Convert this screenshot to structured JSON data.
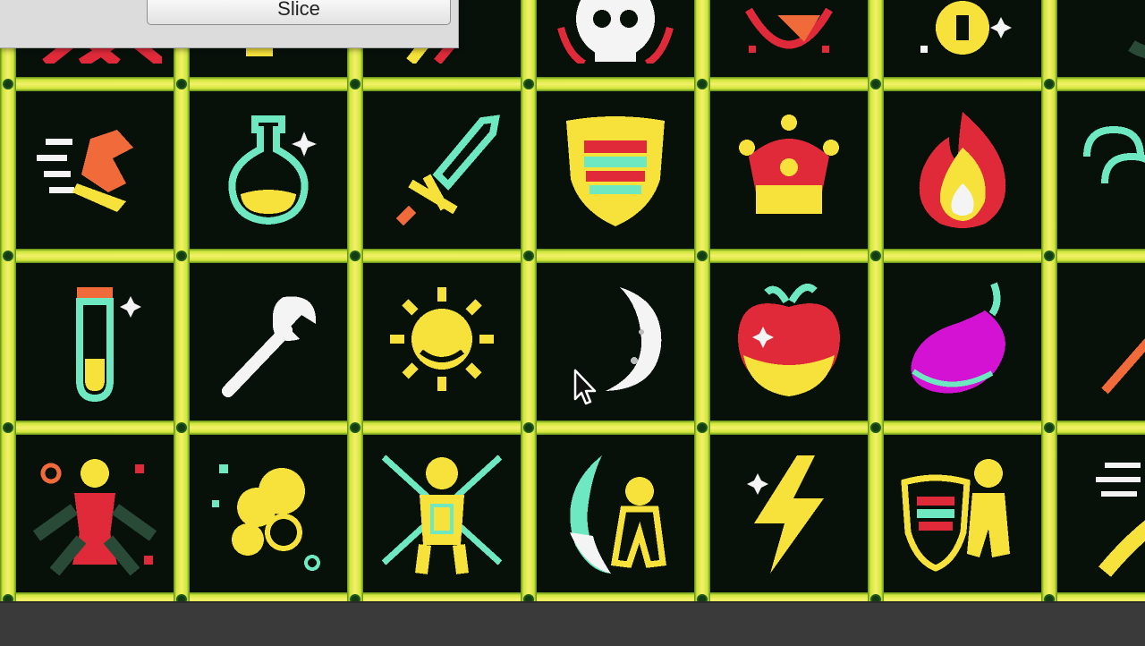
{
  "toolbar": {
    "slice_label": "Slice"
  },
  "sprite_sheet": {
    "colors": {
      "grid_line": "#f4f06a",
      "cell_background": "#07110a",
      "yellow": "#f6e23a",
      "mint": "#6ee8c0",
      "red": "#e02a3a",
      "white": "#f4f4f4",
      "magenta": "#d412d4",
      "orange": "#f06a3a",
      "dark_green": "#2a4a38"
    },
    "rows": [
      {
        "name": "row-top-partial",
        "icons": [
          "unknown-icon",
          "unknown-icon",
          "unknown-icon",
          "skull-icon",
          "shield-icon",
          "key-icon",
          "unknown-icon"
        ]
      },
      {
        "name": "row-1",
        "icons": [
          "dash-boot-icon",
          "potion-flask-icon",
          "sword-icon",
          "striped-shield-icon",
          "crown-icon",
          "fire-icon",
          "wind-swirl-icon"
        ]
      },
      {
        "name": "row-2",
        "icons": [
          "test-tube-potion-icon",
          "wrench-icon",
          "sun-icon",
          "crescent-moon-icon",
          "apple-icon",
          "eggplant-icon",
          "wand-icon"
        ]
      },
      {
        "name": "row-3",
        "icons": [
          "warrior-ability-icon",
          "explosion-cloud-icon",
          "arrows-hero-icon",
          "moon-slash-hero-icon",
          "lightning-icon",
          "shield-hero-icon",
          "dash-figure-icon"
        ]
      }
    ]
  }
}
